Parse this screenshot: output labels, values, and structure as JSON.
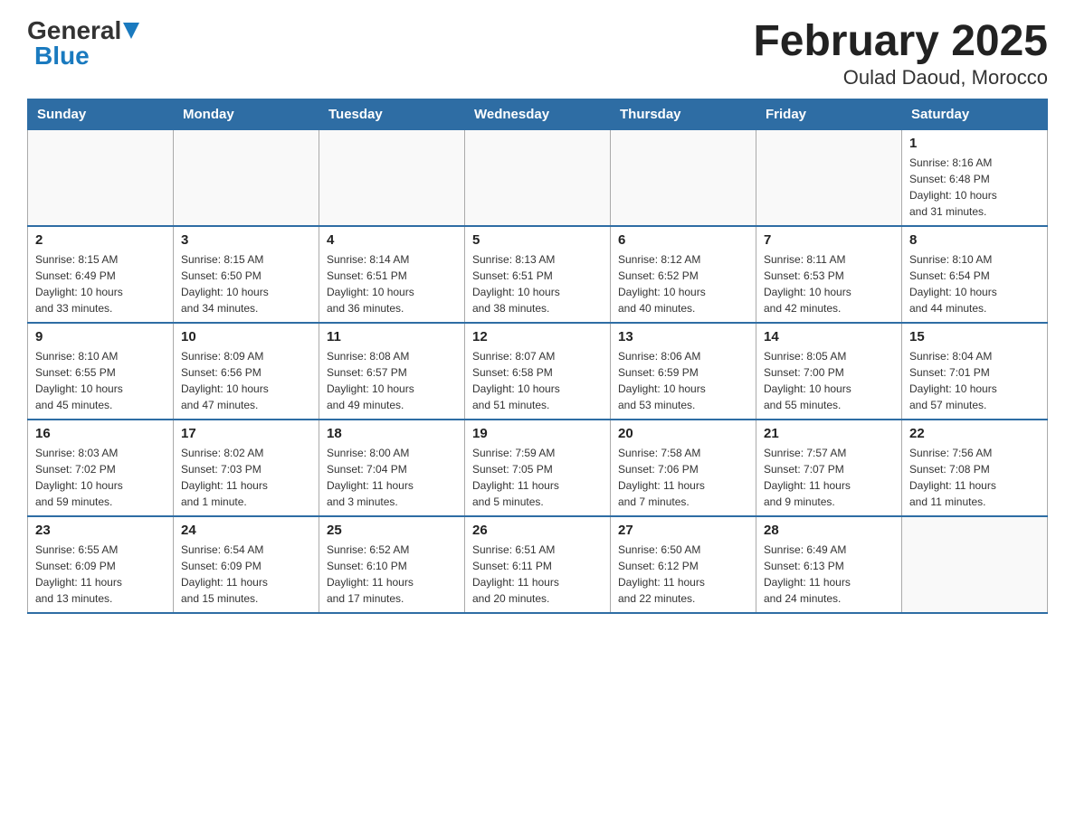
{
  "logo": {
    "general": "General",
    "blue": "Blue"
  },
  "title": "February 2025",
  "subtitle": "Oulad Daoud, Morocco",
  "days_of_week": [
    "Sunday",
    "Monday",
    "Tuesday",
    "Wednesday",
    "Thursday",
    "Friday",
    "Saturday"
  ],
  "weeks": [
    [
      {
        "day": "",
        "info": ""
      },
      {
        "day": "",
        "info": ""
      },
      {
        "day": "",
        "info": ""
      },
      {
        "day": "",
        "info": ""
      },
      {
        "day": "",
        "info": ""
      },
      {
        "day": "",
        "info": ""
      },
      {
        "day": "1",
        "info": "Sunrise: 8:16 AM\nSunset: 6:48 PM\nDaylight: 10 hours\nand 31 minutes."
      }
    ],
    [
      {
        "day": "2",
        "info": "Sunrise: 8:15 AM\nSunset: 6:49 PM\nDaylight: 10 hours\nand 33 minutes."
      },
      {
        "day": "3",
        "info": "Sunrise: 8:15 AM\nSunset: 6:50 PM\nDaylight: 10 hours\nand 34 minutes."
      },
      {
        "day": "4",
        "info": "Sunrise: 8:14 AM\nSunset: 6:51 PM\nDaylight: 10 hours\nand 36 minutes."
      },
      {
        "day": "5",
        "info": "Sunrise: 8:13 AM\nSunset: 6:51 PM\nDaylight: 10 hours\nand 38 minutes."
      },
      {
        "day": "6",
        "info": "Sunrise: 8:12 AM\nSunset: 6:52 PM\nDaylight: 10 hours\nand 40 minutes."
      },
      {
        "day": "7",
        "info": "Sunrise: 8:11 AM\nSunset: 6:53 PM\nDaylight: 10 hours\nand 42 minutes."
      },
      {
        "day": "8",
        "info": "Sunrise: 8:10 AM\nSunset: 6:54 PM\nDaylight: 10 hours\nand 44 minutes."
      }
    ],
    [
      {
        "day": "9",
        "info": "Sunrise: 8:10 AM\nSunset: 6:55 PM\nDaylight: 10 hours\nand 45 minutes."
      },
      {
        "day": "10",
        "info": "Sunrise: 8:09 AM\nSunset: 6:56 PM\nDaylight: 10 hours\nand 47 minutes."
      },
      {
        "day": "11",
        "info": "Sunrise: 8:08 AM\nSunset: 6:57 PM\nDaylight: 10 hours\nand 49 minutes."
      },
      {
        "day": "12",
        "info": "Sunrise: 8:07 AM\nSunset: 6:58 PM\nDaylight: 10 hours\nand 51 minutes."
      },
      {
        "day": "13",
        "info": "Sunrise: 8:06 AM\nSunset: 6:59 PM\nDaylight: 10 hours\nand 53 minutes."
      },
      {
        "day": "14",
        "info": "Sunrise: 8:05 AM\nSunset: 7:00 PM\nDaylight: 10 hours\nand 55 minutes."
      },
      {
        "day": "15",
        "info": "Sunrise: 8:04 AM\nSunset: 7:01 PM\nDaylight: 10 hours\nand 57 minutes."
      }
    ],
    [
      {
        "day": "16",
        "info": "Sunrise: 8:03 AM\nSunset: 7:02 PM\nDaylight: 10 hours\nand 59 minutes."
      },
      {
        "day": "17",
        "info": "Sunrise: 8:02 AM\nSunset: 7:03 PM\nDaylight: 11 hours\nand 1 minute."
      },
      {
        "day": "18",
        "info": "Sunrise: 8:00 AM\nSunset: 7:04 PM\nDaylight: 11 hours\nand 3 minutes."
      },
      {
        "day": "19",
        "info": "Sunrise: 7:59 AM\nSunset: 7:05 PM\nDaylight: 11 hours\nand 5 minutes."
      },
      {
        "day": "20",
        "info": "Sunrise: 7:58 AM\nSunset: 7:06 PM\nDaylight: 11 hours\nand 7 minutes."
      },
      {
        "day": "21",
        "info": "Sunrise: 7:57 AM\nSunset: 7:07 PM\nDaylight: 11 hours\nand 9 minutes."
      },
      {
        "day": "22",
        "info": "Sunrise: 7:56 AM\nSunset: 7:08 PM\nDaylight: 11 hours\nand 11 minutes."
      }
    ],
    [
      {
        "day": "23",
        "info": "Sunrise: 6:55 AM\nSunset: 6:09 PM\nDaylight: 11 hours\nand 13 minutes."
      },
      {
        "day": "24",
        "info": "Sunrise: 6:54 AM\nSunset: 6:09 PM\nDaylight: 11 hours\nand 15 minutes."
      },
      {
        "day": "25",
        "info": "Sunrise: 6:52 AM\nSunset: 6:10 PM\nDaylight: 11 hours\nand 17 minutes."
      },
      {
        "day": "26",
        "info": "Sunrise: 6:51 AM\nSunset: 6:11 PM\nDaylight: 11 hours\nand 20 minutes."
      },
      {
        "day": "27",
        "info": "Sunrise: 6:50 AM\nSunset: 6:12 PM\nDaylight: 11 hours\nand 22 minutes."
      },
      {
        "day": "28",
        "info": "Sunrise: 6:49 AM\nSunset: 6:13 PM\nDaylight: 11 hours\nand 24 minutes."
      },
      {
        "day": "",
        "info": ""
      }
    ]
  ]
}
